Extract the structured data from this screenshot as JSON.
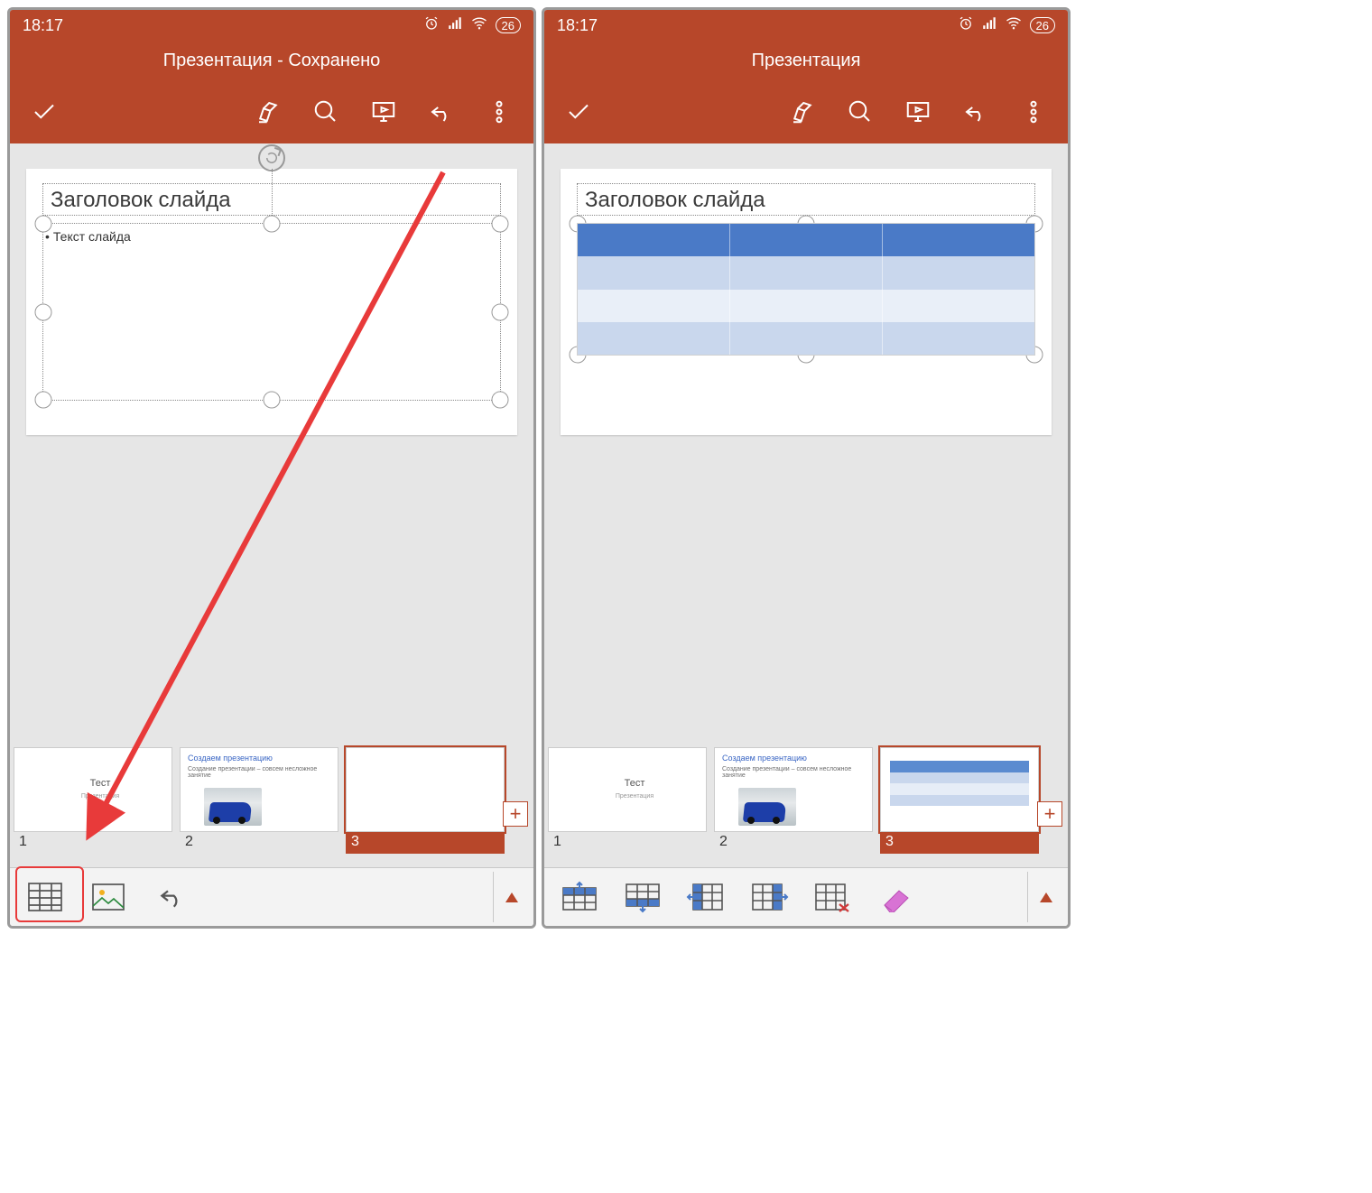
{
  "status": {
    "time": "18:17",
    "battery": "26"
  },
  "left": {
    "title": "Презентация - Сохранено",
    "slide_title_placeholder": "Заголовок слайда",
    "slide_body_text": "Текст слайда",
    "thumbs": {
      "n1": "1",
      "n2": "2",
      "n3": "3",
      "t1_title": "Тест",
      "t1_sub": "Презентация",
      "t2_title": "Создаем презентацию",
      "t2_sub": "Создание презентации – совсем несложное занятие"
    }
  },
  "right": {
    "title": "Презентация",
    "slide_title_placeholder": "Заголовок слайда",
    "thumbs": {
      "n1": "1",
      "n2": "2",
      "n3": "3",
      "t1_title": "Тест",
      "t1_sub": "Презентация",
      "t2_title": "Создаем презентацию",
      "t2_sub": "Создание презентации – совсем несложное занятие"
    }
  },
  "icons": {
    "done": "done-icon",
    "pen": "pen-edit-icon",
    "search": "search-icon",
    "present": "present-icon",
    "undo": "undo-icon",
    "more": "more-vertical-icon",
    "alarm": "alarm-icon",
    "signal": "signal-icon",
    "wifi": "wifi-icon",
    "table": "table-icon",
    "image": "image-icon",
    "undo2": "undo-icon",
    "expand": "expand-up-icon",
    "row_above": "insert-row-above-icon",
    "row_below": "insert-row-below-icon",
    "col_left": "insert-column-left-icon",
    "col_right": "insert-column-right-icon",
    "del": "delete-table-icon",
    "erase": "eraser-icon"
  }
}
